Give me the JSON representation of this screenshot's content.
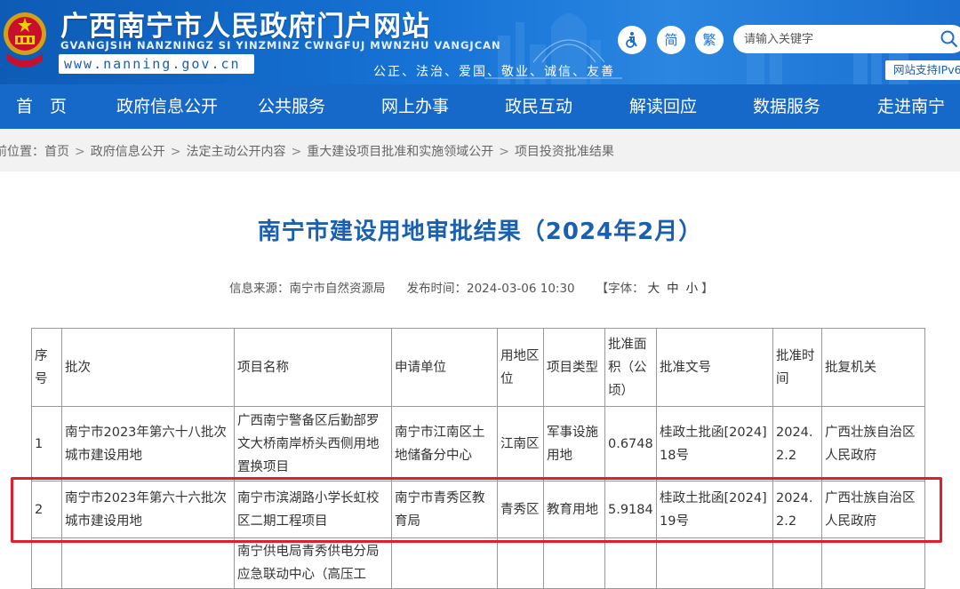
{
  "header": {
    "site_name": "广西南宁市人民政府门户网站",
    "site_name_pinyin": "GVANGJSIH NANZNINGZ SI YINZMINZ CWNGFUJ MWNZHU VANGJCAN",
    "url": "www.nanning.gov.cn",
    "values": "公正、法治、爱国、敬业、诚信、友善",
    "lang_simplified": "简",
    "lang_traditional": "繁",
    "search_placeholder": "请输入关键字",
    "ipv6_badge": "网站支持IPv6"
  },
  "nav": {
    "items": [
      "首　页",
      "政府信息公开",
      "公共服务",
      "网上办事",
      "政民互动",
      "解读回应",
      "数据服务",
      "走进南宁"
    ]
  },
  "breadcrumb": {
    "prefix": "前位置：",
    "items": [
      "首页",
      "政府信息公开",
      "法定主动公开内容",
      "重大建设项目批准和实施领域公开",
      "项目投资批准结果"
    ],
    "separator": ">"
  },
  "article": {
    "title": "南宁市建设用地审批结果（2024年2月）",
    "source_label": "信息来源：南宁市自然资源局",
    "publish_label": "发布时间：2024-03-06 10:30",
    "font_size_label": "【字体：",
    "font_large": "大",
    "font_medium": "中",
    "font_small": "小",
    "font_size_close": "】"
  },
  "table": {
    "headers": [
      "序号",
      "批次",
      "项目名称",
      "申请单位",
      "用地区位",
      "项目类型",
      "批准面积（公顷）",
      "批准文号",
      "批准时间",
      "批复机关"
    ],
    "rows": [
      [
        "1",
        "南宁市2023年第六十八批次城市建设用地",
        "广西南宁警备区后勤部罗文大桥南岸桥头西侧用地置换项目",
        "南宁市江南区土地储备分中心",
        "江南区",
        "军事设施用地",
        "0.6748",
        "桂政土批函[2024]18号",
        "2024.2.2",
        "广西壮族自治区人民政府"
      ],
      [
        "2",
        "南宁市2023年第六十六批次城市建设用地",
        "南宁市滨湖路小学长虹校区二期工程项目",
        "南宁市青秀区教育局",
        "青秀区",
        "教育用地",
        "5.9184",
        "桂政土批函[2024]19号",
        "2024.2.2",
        "广西壮族自治区人民政府"
      ],
      [
        "",
        "",
        "南宁供电局青秀供电分局应急联动中心（高压工",
        "",
        "",
        "",
        "",
        "",
        "",
        ""
      ]
    ]
  },
  "colors": {
    "header_blue": "#1673d6",
    "nav_blue": "#1769c9",
    "title_blue": "#1a5fb0",
    "highlight_red": "#e01e2e"
  },
  "icons": [
    "national-emblem-icon",
    "accessibility-icon",
    "search-icon"
  ]
}
